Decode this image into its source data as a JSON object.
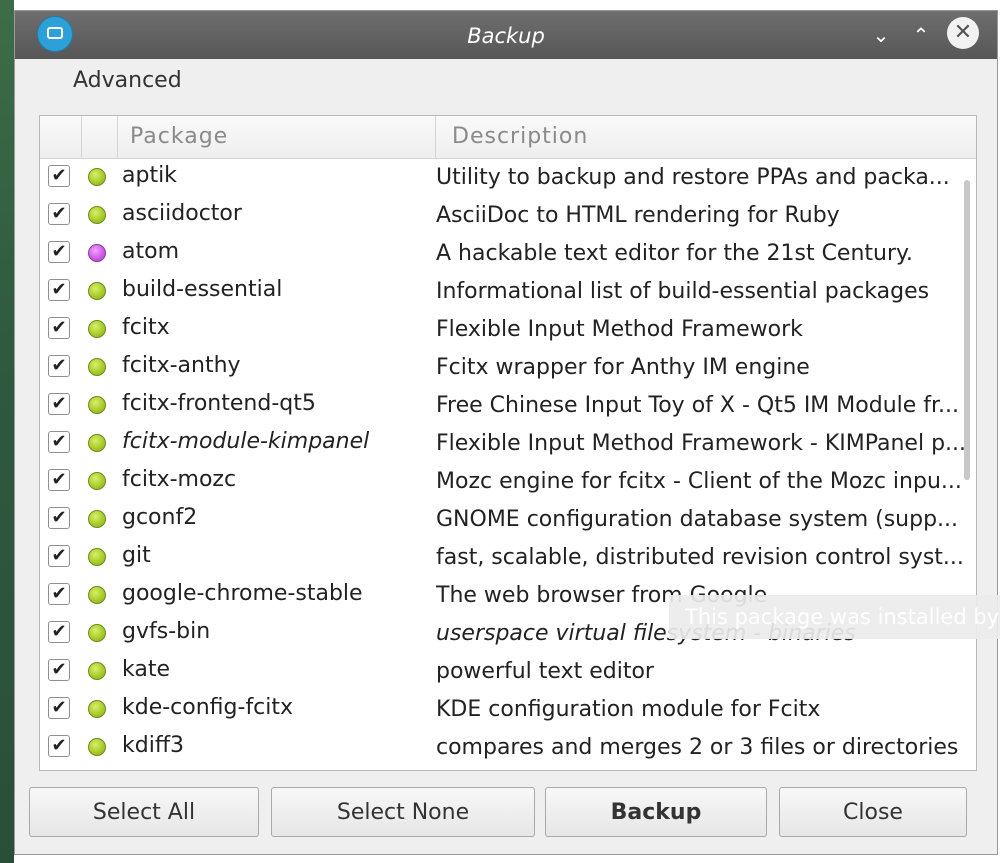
{
  "window": {
    "title": "Backup",
    "minimize_glyph": "⌄",
    "maximize_glyph": "⌃",
    "close_glyph": "✕"
  },
  "menu": {
    "advanced": "Advanced"
  },
  "table": {
    "columns": {
      "package": "Package",
      "description": "Description"
    },
    "rows": [
      {
        "checked": true,
        "status": "green",
        "package": "aptik",
        "description": "Utility to backup and restore PPAs and packa..."
      },
      {
        "checked": true,
        "status": "green",
        "package": "asciidoctor",
        "description": "AsciiDoc to HTML rendering for Ruby"
      },
      {
        "checked": true,
        "status": "purple",
        "package": "atom",
        "description": "A hackable text editor for the 21st Century."
      },
      {
        "checked": true,
        "status": "green",
        "package": "build-essential",
        "description": "Informational list of build-essential packages"
      },
      {
        "checked": true,
        "status": "green",
        "package": "fcitx",
        "description": "Flexible Input Method Framework"
      },
      {
        "checked": true,
        "status": "green",
        "package": "fcitx-anthy",
        "description": "Fcitx wrapper for Anthy IM engine"
      },
      {
        "checked": true,
        "status": "green",
        "package": "fcitx-frontend-qt5",
        "description": "Free Chinese Input Toy of X - Qt5 IM Module fr..."
      },
      {
        "checked": true,
        "status": "green",
        "package": "fcitx-module-kimpanel",
        "description": "Flexible Input Method Framework - KIMPanel p...",
        "italic": true
      },
      {
        "checked": true,
        "status": "green",
        "package": "fcitx-mozc",
        "description": "Mozc engine for fcitx - Client of the Mozc inpu..."
      },
      {
        "checked": true,
        "status": "green",
        "package": "gconf2",
        "description": "GNOME configuration database system (supp..."
      },
      {
        "checked": true,
        "status": "green",
        "package": "git",
        "description": "fast, scalable, distributed revision control syst..."
      },
      {
        "checked": true,
        "status": "green",
        "package": "google-chrome-stable",
        "description": "The web browser from Google"
      },
      {
        "checked": true,
        "status": "green",
        "package": "gvfs-bin",
        "description": "userspace virtual filesystem - binaries",
        "desc_italic": true
      },
      {
        "checked": true,
        "status": "green",
        "package": "kate",
        "description": "powerful text editor"
      },
      {
        "checked": true,
        "status": "green",
        "package": "kde-config-fcitx",
        "description": "KDE configuration module for Fcitx"
      },
      {
        "checked": true,
        "status": "green",
        "package": "kdiff3",
        "description": "compares and merges 2 or 3 files or directories"
      }
    ]
  },
  "tooltip": "This package was installed by",
  "buttons": {
    "select_all": "Select All",
    "select_none": "Select None",
    "backup": "Backup",
    "close": "Close"
  },
  "colors": {
    "status_green": "#a8cc2a",
    "status_purple": "#cf5ce6",
    "titlebar": "#616161"
  }
}
